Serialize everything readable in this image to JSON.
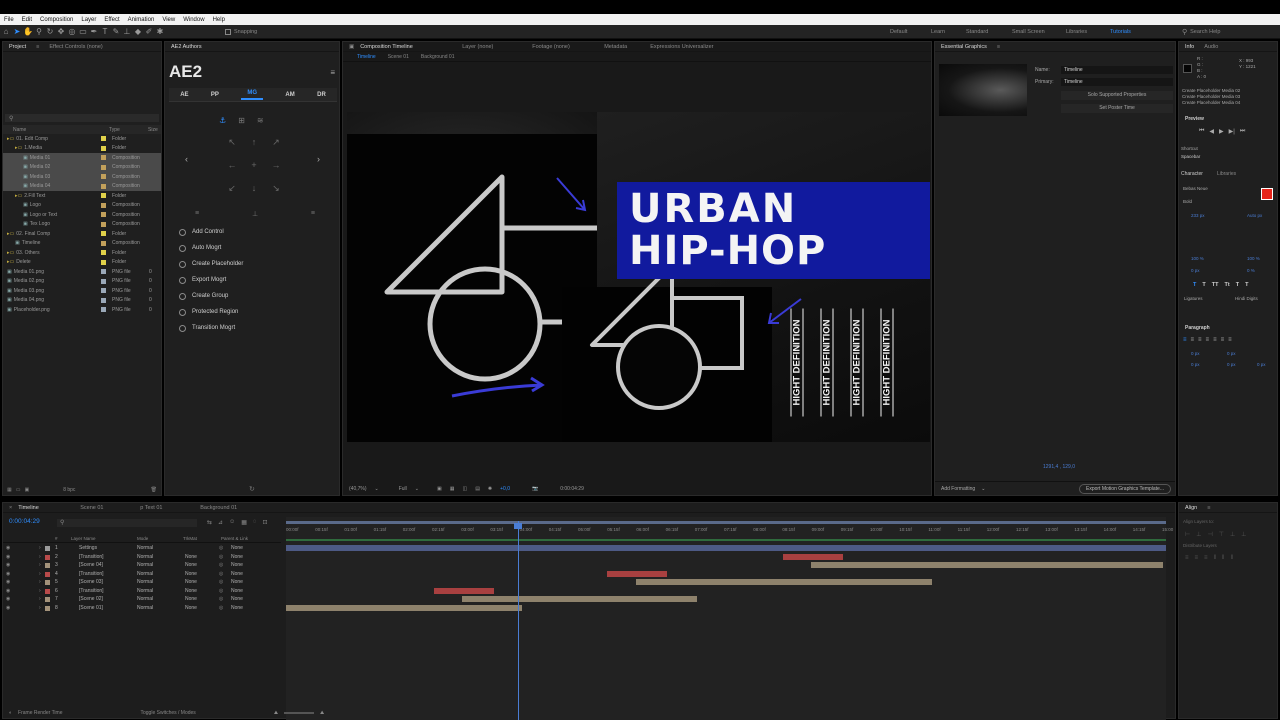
{
  "menu": [
    "File",
    "Edit",
    "Composition",
    "Layer",
    "Effect",
    "Animation",
    "View",
    "Window",
    "Help"
  ],
  "toolbar": {
    "snapping": "Snapping"
  },
  "workspaces": [
    "Default",
    "Learn",
    "Standard",
    "Small Screen",
    "Libraries",
    "Tutorials"
  ],
  "search_help": "Search Help",
  "project": {
    "tabs": [
      "Project",
      "Effect Controls (none)"
    ],
    "columns": [
      "Name",
      "Type",
      "Size"
    ],
    "items": [
      {
        "name": "01. Edit Comp",
        "type": "Folder",
        "size": "",
        "color": "#e0d14a",
        "indent": 0,
        "sel": false
      },
      {
        "name": "1.Media",
        "type": "Folder",
        "size": "",
        "color": "#e0d14a",
        "indent": 1,
        "sel": false
      },
      {
        "name": "Media 01",
        "type": "Composition",
        "size": "",
        "color": "#c2a05b",
        "indent": 2,
        "sel": true
      },
      {
        "name": "Media 02",
        "type": "Composition",
        "size": "",
        "color": "#c2a05b",
        "indent": 2,
        "sel": true
      },
      {
        "name": "Media 03",
        "type": "Composition",
        "size": "",
        "color": "#c2a05b",
        "indent": 2,
        "sel": true
      },
      {
        "name": "Media 04",
        "type": "Composition",
        "size": "",
        "color": "#c2a05b",
        "indent": 2,
        "sel": true
      },
      {
        "name": "2.Fill Text",
        "type": "Folder",
        "size": "",
        "color": "#e0d14a",
        "indent": 1,
        "sel": false
      },
      {
        "name": "Logo",
        "type": "Composition",
        "size": "",
        "color": "#c2a05b",
        "indent": 2,
        "sel": false
      },
      {
        "name": "Logo or Text",
        "type": "Composition",
        "size": "",
        "color": "#c2a05b",
        "indent": 2,
        "sel": false
      },
      {
        "name": "Tex Logo",
        "type": "Composition",
        "size": "",
        "color": "#c2a05b",
        "indent": 2,
        "sel": false
      },
      {
        "name": "02. Final Comp",
        "type": "Folder",
        "size": "",
        "color": "#e0d14a",
        "indent": 0,
        "sel": false
      },
      {
        "name": "Timeline",
        "type": "Composition",
        "size": "",
        "color": "#c2a05b",
        "indent": 1,
        "sel": false
      },
      {
        "name": "03. Others",
        "type": "Folder",
        "size": "",
        "color": "#e0d14a",
        "indent": 0,
        "sel": false
      },
      {
        "name": "Delete",
        "type": "Folder",
        "size": "",
        "color": "#e0d14a",
        "indent": 0,
        "sel": false
      },
      {
        "name": "Media 01.png",
        "type": "PNG file",
        "size": "0",
        "color": "#9aa8b8",
        "indent": 0,
        "sel": false
      },
      {
        "name": "Media 02.png",
        "type": "PNG file",
        "size": "0",
        "color": "#9aa8b8",
        "indent": 0,
        "sel": false
      },
      {
        "name": "Media 03.png",
        "type": "PNG file",
        "size": "0",
        "color": "#9aa8b8",
        "indent": 0,
        "sel": false
      },
      {
        "name": "Media 04.png",
        "type": "PNG file",
        "size": "0",
        "color": "#9aa8b8",
        "indent": 0,
        "sel": false
      },
      {
        "name": "Placeholder.png",
        "type": "PNG file",
        "size": "0",
        "color": "#9aa8b8",
        "indent": 0,
        "sel": false
      }
    ],
    "bpc": "8 bpc"
  },
  "ae2": {
    "tab": "AE2 Authors",
    "title": "AE2",
    "tabs": [
      "AE",
      "PP",
      "MG",
      "AM",
      "DR"
    ],
    "active_tab": "MG",
    "actions": [
      "Add Control",
      "Auto Mogrt",
      "Create Placeholder",
      "Export Mogrt",
      "Create Group",
      "Protected Region",
      "Transition Mogrt"
    ]
  },
  "comp": {
    "tabs": [
      "Composition Timeline",
      "Layer (none)",
      "Footage (none)",
      "Metadata",
      "Expressions Universalizer"
    ],
    "breadcrumbs": [
      "Timeline",
      "Scene 01",
      "Background 01"
    ],
    "title1": "URBAN",
    "title2": "HIP-HOP",
    "vertical_text": "HIGHT DEFINITION",
    "zoom": "(40,7%)",
    "quality": "Full",
    "timecode": "0:00:04:29",
    "plus": "+0,0"
  },
  "essential_graphics": {
    "tab": "Essential Graphics",
    "name_label": "Name:",
    "name_value": "Timeline",
    "primary_label": "Primary:",
    "primary_value": "Timeline",
    "solo_button": "Solo Supported Properties",
    "poster_button": "Set Poster Time",
    "coords": "1291,4 , 129,0",
    "add_formatting": "Add Formatting",
    "export_button": "Export Motion Graphics Template..."
  },
  "info": {
    "tabs": [
      "Info",
      "Audio"
    ],
    "rgb": [
      "R :",
      "G :",
      "B :",
      "A : 0"
    ],
    "xy": [
      "X : 993",
      "Y : 1221"
    ],
    "lines": [
      "Create Placeholder Media 02",
      "Create Placeholder Media 03",
      "Create Placeholder Media 04"
    ]
  },
  "preview": {
    "title": "Preview",
    "shortcut_label": "Shortcut",
    "shortcut_value": "Spacebar"
  },
  "character": {
    "tabs": [
      "Character",
      "Libraries"
    ],
    "font": "Bebas Neue",
    "style": "Bold",
    "size": "233 px",
    "leading": "Auto px",
    "scale_v": "100 %",
    "scale_h": "100 %",
    "baseline": "0 px",
    "tsume": "0 %",
    "ligatures": "Ligatures",
    "hindi": "Hindi Digits"
  },
  "paragraph": {
    "title": "Paragraph",
    "values": [
      "0 px",
      "0 px",
      "0 px",
      "0 px",
      "0 px"
    ]
  },
  "align": {
    "title": "Align",
    "align_layers_to": "Align Layers to:",
    "distribute": "Distribute Layers"
  },
  "timeline": {
    "tabs": [
      "Timeline",
      "Scene 01",
      "p Text 01",
      "Background 01"
    ],
    "timecode": "0:00:04:29",
    "columns": [
      "#",
      "Layer Name",
      "Mode",
      "TrkMat",
      "Parent & Link"
    ],
    "ticks": [
      "00:00f",
      "00:15f",
      "01:00f",
      "01:15f",
      "02:00f",
      "02:15f",
      "03:00f",
      "03:15f",
      "04:00f",
      "04:15f",
      "05:00f",
      "05:15f",
      "06:00f",
      "06:15f",
      "07:00f",
      "07:15f",
      "08:00f",
      "08:15f",
      "09:00f",
      "09:15f",
      "10:00f",
      "10:15f",
      "11:00f",
      "11:15f",
      "12:00f",
      "12:15f",
      "13:00f",
      "13:15f",
      "14:00f",
      "14:15f",
      "15:00"
    ],
    "layers": [
      {
        "num": "1",
        "name": "Settings",
        "mode": "Normal",
        "trkmat": "",
        "parent": "None",
        "color": "#9a9a9a"
      },
      {
        "num": "2",
        "name": "[Transition]",
        "mode": "Normal",
        "trkmat": "None",
        "parent": "None",
        "color": "#b84a4a"
      },
      {
        "num": "3",
        "name": "[Scene 04]",
        "mode": "Normal",
        "trkmat": "None",
        "parent": "None",
        "color": "#a3927a"
      },
      {
        "num": "4",
        "name": "[Transition]",
        "mode": "Normal",
        "trkmat": "None",
        "parent": "None",
        "color": "#b84a4a"
      },
      {
        "num": "5",
        "name": "[Scene 03]",
        "mode": "Normal",
        "trkmat": "None",
        "parent": "None",
        "color": "#a3927a"
      },
      {
        "num": "6",
        "name": "[Transition]",
        "mode": "Normal",
        "trkmat": "None",
        "parent": "None",
        "color": "#b84a4a"
      },
      {
        "num": "7",
        "name": "[Scene 02]",
        "mode": "Normal",
        "trkmat": "None",
        "parent": "None",
        "color": "#a3927a"
      },
      {
        "num": "8",
        "name": "[Scene 01]",
        "mode": "Normal",
        "trkmat": "None",
        "parent": "None",
        "color": "#a3927a"
      }
    ],
    "bottom_left": "Frame Render Time",
    "toggle": "Toggle Switches / Modes"
  }
}
